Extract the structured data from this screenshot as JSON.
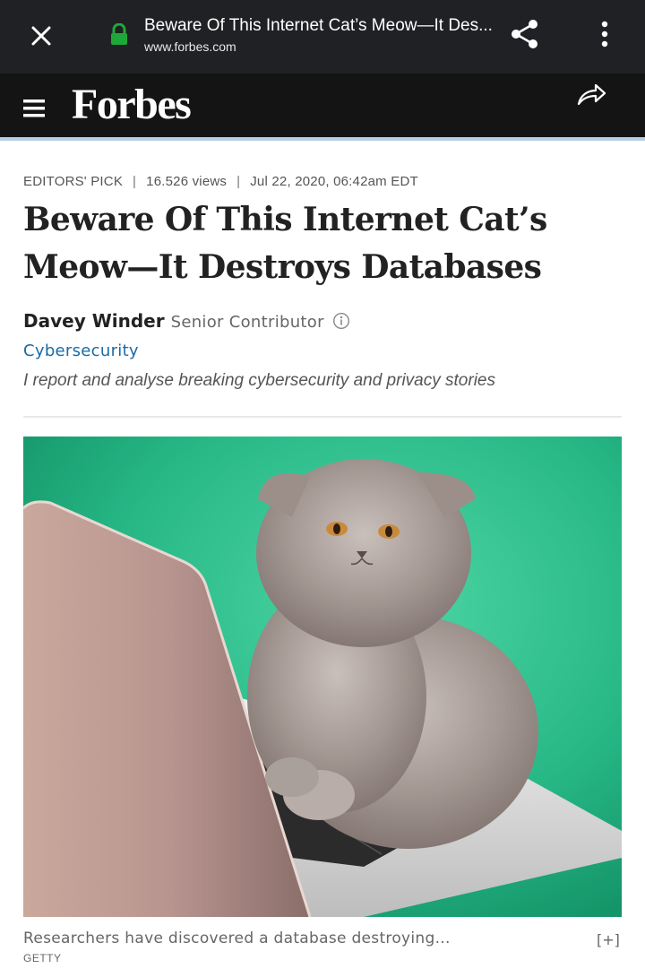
{
  "browser": {
    "tab_title": "Beware Of This Internet Cat’s Meow—It Des...",
    "url": "www.forbes.com",
    "icons": [
      "close-icon",
      "lock-icon",
      "share-icon",
      "more-vert-icon"
    ],
    "lock_color": "#1fa83a"
  },
  "site": {
    "logo": "Forbes",
    "icons": [
      "hamburger-icon",
      "share-arrow-icon"
    ]
  },
  "article": {
    "meta": {
      "label": "EDITORS' PICK",
      "views": "16.526 views",
      "date": "Jul 22, 2020, 06:42am EDT"
    },
    "headline": "Beware Of This Internet Cat’s Meow—It Destroys Databases",
    "author": "Davey Winder",
    "role": "Senior Contributor",
    "section": "Cybersecurity",
    "bio": "I report and analyse breaking cybersecurity and privacy stories",
    "image": {
      "caption": "Researchers have discovered a database destroying...",
      "expand_label": "[+]",
      "credit": "GETTY"
    }
  },
  "colors": {
    "chrome_bg": "#202124",
    "header_bg": "#141414",
    "link": "#1a6aa5",
    "hero_bg": "#2bb789"
  }
}
